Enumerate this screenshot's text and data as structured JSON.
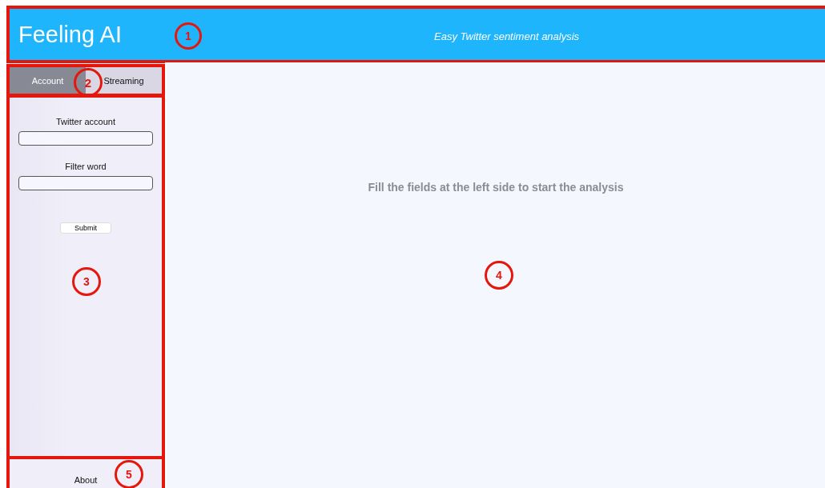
{
  "header": {
    "title": "Feeling AI",
    "subtitle": "Easy Twitter sentiment analysis",
    "callout": "1"
  },
  "tabs": {
    "callout": "2",
    "items": [
      {
        "label": "Account",
        "selected": true
      },
      {
        "label": "Streaming",
        "selected": false
      }
    ]
  },
  "form": {
    "callout": "3",
    "fields": [
      {
        "label": "Twitter account"
      },
      {
        "label": "Filter word"
      }
    ],
    "submit": "Submit"
  },
  "main": {
    "callout": "4",
    "message": "Fill the fields at the left side to start the analysis"
  },
  "footer": {
    "callout": "5",
    "link": "About"
  }
}
